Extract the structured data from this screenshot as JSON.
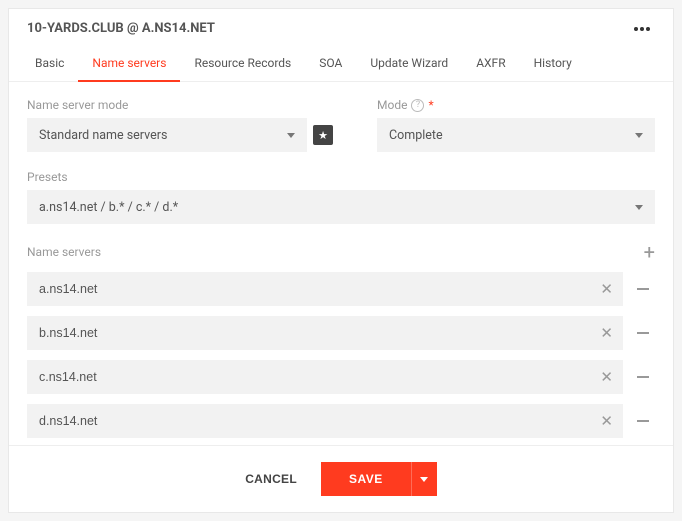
{
  "header": {
    "title": "10-YARDS.CLUB @ A.NS14.NET"
  },
  "tabs": [
    {
      "label": "Basic"
    },
    {
      "label": "Name servers"
    },
    {
      "label": "Resource Records"
    },
    {
      "label": "SOA"
    },
    {
      "label": "Update Wizard"
    },
    {
      "label": "AXFR"
    },
    {
      "label": "History"
    }
  ],
  "active_tab_index": 1,
  "fields": {
    "name_server_mode": {
      "label": "Name server mode",
      "value": "Standard name servers"
    },
    "mode": {
      "label": "Mode",
      "value": "Complete"
    },
    "presets": {
      "label": "Presets",
      "value": "a.ns14.net / b.* / c.* / d.*"
    },
    "name_servers": {
      "label": "Name servers",
      "items": [
        {
          "value": "a.ns14.net"
        },
        {
          "value": "b.ns14.net"
        },
        {
          "value": "c.ns14.net"
        },
        {
          "value": "d.ns14.net"
        }
      ]
    }
  },
  "footer": {
    "cancel_label": "CANCEL",
    "save_label": "SAVE"
  }
}
